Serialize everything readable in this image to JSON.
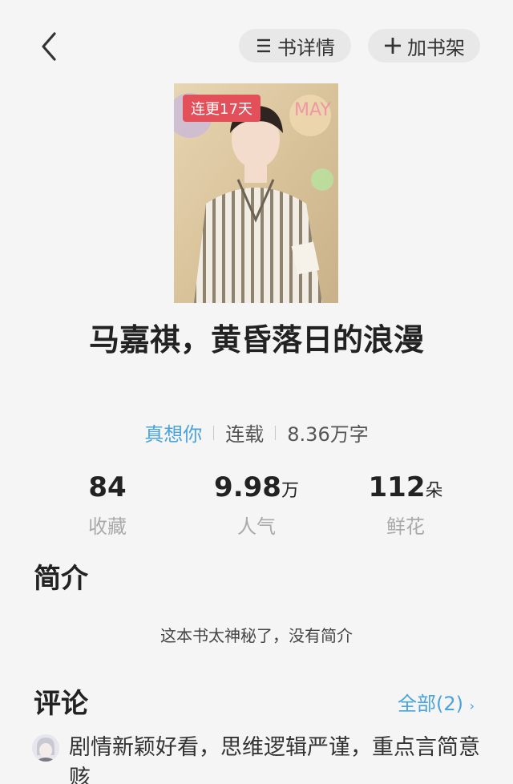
{
  "header": {
    "detail_label": "书详情",
    "shelf_label": "加书架",
    "icons": {
      "back": "back-arrow-icon",
      "detail": "list-icon",
      "shelf": "plus-icon"
    }
  },
  "book": {
    "cover_badge": "连更17天",
    "title": "马嘉祺，黄昏落日的浪漫",
    "author": "真想你",
    "status": "连载",
    "word_count": "8.36万字"
  },
  "stats": [
    {
      "value": "84",
      "unit": "",
      "label": "收藏"
    },
    {
      "value": "9.98",
      "unit": "万",
      "label": "人气"
    },
    {
      "value": "112",
      "unit": "朵",
      "label": "鲜花"
    }
  ],
  "intro": {
    "heading": "简介",
    "text": "这本书太神秘了，没有简介"
  },
  "comments": {
    "heading": "评论",
    "all_label": "全部(2)",
    "first_comment": "剧情新颖好看，思维逻辑严谨，重点言简意赅"
  },
  "colors": {
    "accent": "#4aa3dc",
    "badge": "#e4505a",
    "background": "#f5f5f5"
  }
}
